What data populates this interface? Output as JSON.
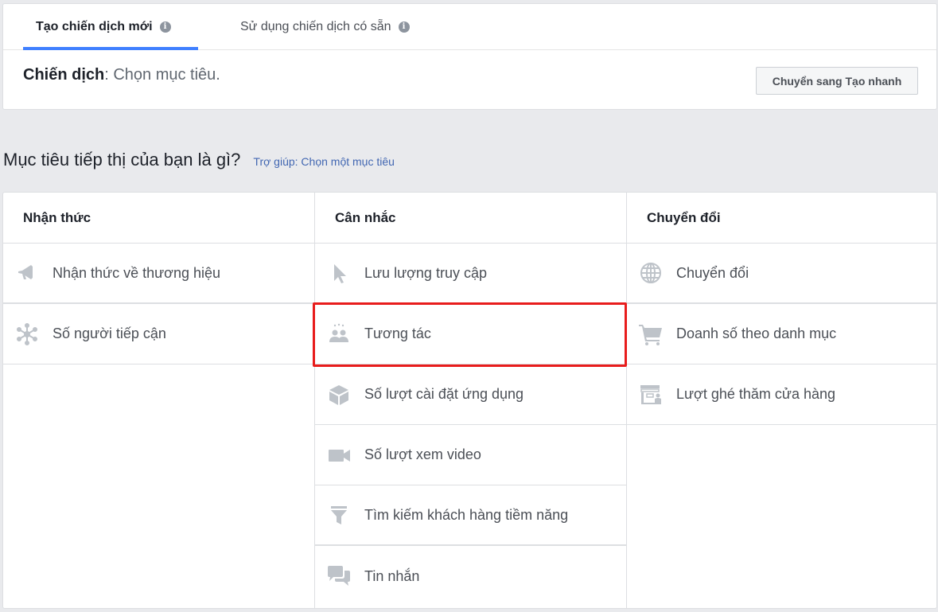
{
  "tabs": [
    {
      "label": "Tạo chiến dịch mới",
      "active": true
    },
    {
      "label": "Sử dụng chiến dịch có sẵn",
      "active": false
    }
  ],
  "info_glyph": "i",
  "campaign": {
    "label": "Chiến dịch",
    "text": ": Chọn mục tiêu."
  },
  "quick_create_button": "Chuyển sang Tạo nhanh",
  "question": "Mục tiêu tiếp thị của bạn là gì?",
  "help_link": "Trợ giúp: Chọn một mục tiêu",
  "columns": [
    {
      "header": "Nhận thức",
      "options": [
        {
          "label": "Nhận thức về thương hiệu",
          "icon": "megaphone-icon"
        },
        {
          "label": "Số người tiếp cận",
          "icon": "reach-network-icon"
        }
      ]
    },
    {
      "header": "Cân nhắc",
      "options": [
        {
          "label": "Lưu lượng truy cập",
          "icon": "cursor-icon"
        },
        {
          "label": "Tương tác",
          "icon": "people-engagement-icon",
          "highlighted": true
        },
        {
          "label": "Số lượt cài đặt ứng dụng",
          "icon": "box-icon"
        },
        {
          "label": "Số lượt xem video",
          "icon": "video-camera-icon"
        },
        {
          "label": "Tìm kiếm khách hàng tiềm năng",
          "icon": "funnel-icon"
        },
        {
          "label": "Tin nhắn",
          "icon": "chat-bubbles-icon"
        }
      ]
    },
    {
      "header": "Chuyển đổi",
      "options": [
        {
          "label": "Chuyển đổi",
          "icon": "globe-icon"
        },
        {
          "label": "Doanh số theo danh mục",
          "icon": "shopping-cart-icon"
        },
        {
          "label": "Lượt ghé thăm cửa hàng",
          "icon": "store-icon"
        }
      ]
    }
  ],
  "colors": {
    "accent": "#4080ff",
    "highlight_border": "#e81c1c",
    "icon": "#bec3c9",
    "link": "#4267b2"
  }
}
